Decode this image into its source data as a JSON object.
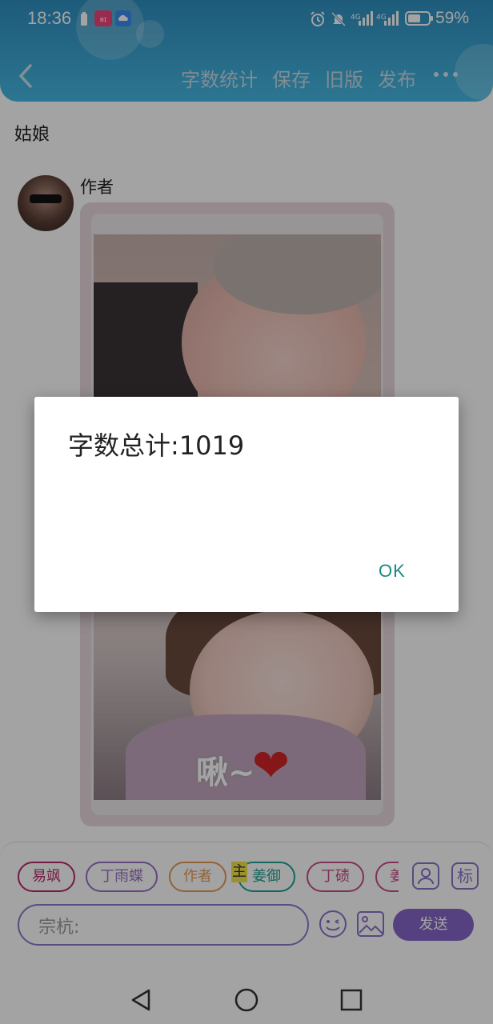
{
  "status_bar": {
    "time": "18:36",
    "battery_percent": "59%",
    "signal_label_1": "4G",
    "signal_label_2": "4G"
  },
  "toolbar": {
    "back_icon": "chevron-left-icon",
    "actions": [
      "字数统计",
      "保存",
      "旧版",
      "发布"
    ],
    "more_icon": "more-dots-icon"
  },
  "post": {
    "title": "姑娘",
    "author_name": "作者",
    "sticker_text": "啾~"
  },
  "composer": {
    "chips": [
      {
        "label": "易飒",
        "color": "#b8286c"
      },
      {
        "label": "丁雨蝶",
        "color": "#9a6fc7"
      },
      {
        "label": "作者",
        "color": "#e69a55"
      },
      {
        "label": "姜御",
        "color": "#1aa394"
      },
      {
        "label": "丁碛",
        "color": "#c94c8c"
      },
      {
        "label": "姜",
        "color": "#c94c8c"
      }
    ],
    "highlight_char": "主",
    "contact_icon": "person-card-icon",
    "tag_label": "标",
    "input_value": "宗杭:",
    "emoji_icon": "emoji-icon",
    "image_icon": "image-icon",
    "send_label": "发送",
    "accent_color": "#8564c8"
  },
  "dialog": {
    "message": "字数总计:1019",
    "ok_label": "OK"
  },
  "system_nav": {
    "back_icon": "triangle-back-icon",
    "home_icon": "circle-home-icon",
    "recents_icon": "square-recents-icon"
  }
}
